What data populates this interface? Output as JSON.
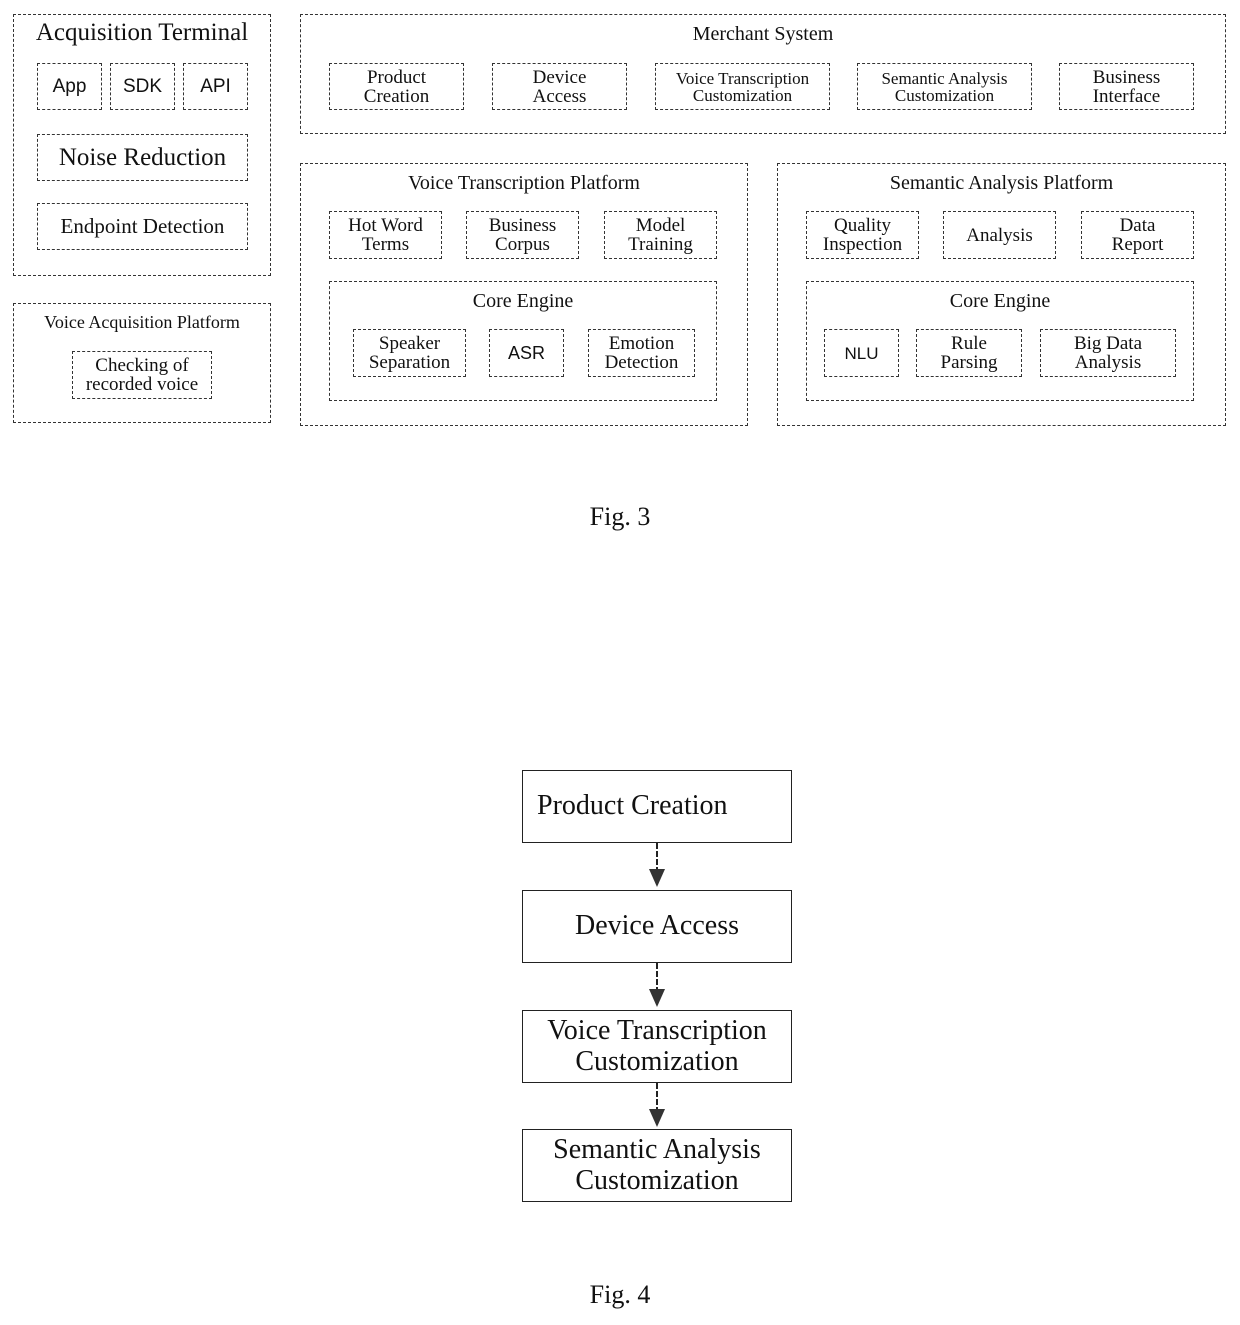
{
  "fig3": {
    "caption": "Fig. 3",
    "acquisition_terminal": {
      "title": "Acquisition Terminal",
      "items": [
        "App",
        "SDK",
        "API"
      ],
      "noise_reduction": "Noise Reduction",
      "endpoint_detection": "Endpoint Detection"
    },
    "voice_acquisition_platform": {
      "title": "Voice Acquisition Platform",
      "item": "Checking of\nrecorded voice"
    },
    "merchant_system": {
      "title": "Merchant System",
      "items": [
        "Product\nCreation",
        "Device\nAccess",
        "Voice Transcription\nCustomization",
        "Semantic Analysis\nCustomization",
        "Business\nInterface"
      ]
    },
    "voice_transcription_platform": {
      "title": "Voice Transcription Platform",
      "items": [
        "Hot Word\nTerms",
        "Business\nCorpus",
        "Model\nTraining"
      ],
      "core_engine": {
        "title": "Core Engine",
        "items": [
          "Speaker\nSeparation",
          "ASR",
          "Emotion\nDetection"
        ]
      }
    },
    "semantic_analysis_platform": {
      "title": "Semantic Analysis Platform",
      "items": [
        "Quality\nInspection",
        "Analysis",
        "Data\nReport"
      ],
      "core_engine": {
        "title": "Core Engine",
        "items": [
          "NLU",
          "Rule\nParsing",
          "Big Data\nAnalysis"
        ]
      }
    }
  },
  "fig4": {
    "caption": "Fig. 4",
    "steps": [
      "Product Creation",
      "Device Access",
      "Voice Transcription\nCustomization",
      "Semantic Analysis\nCustomization"
    ]
  }
}
